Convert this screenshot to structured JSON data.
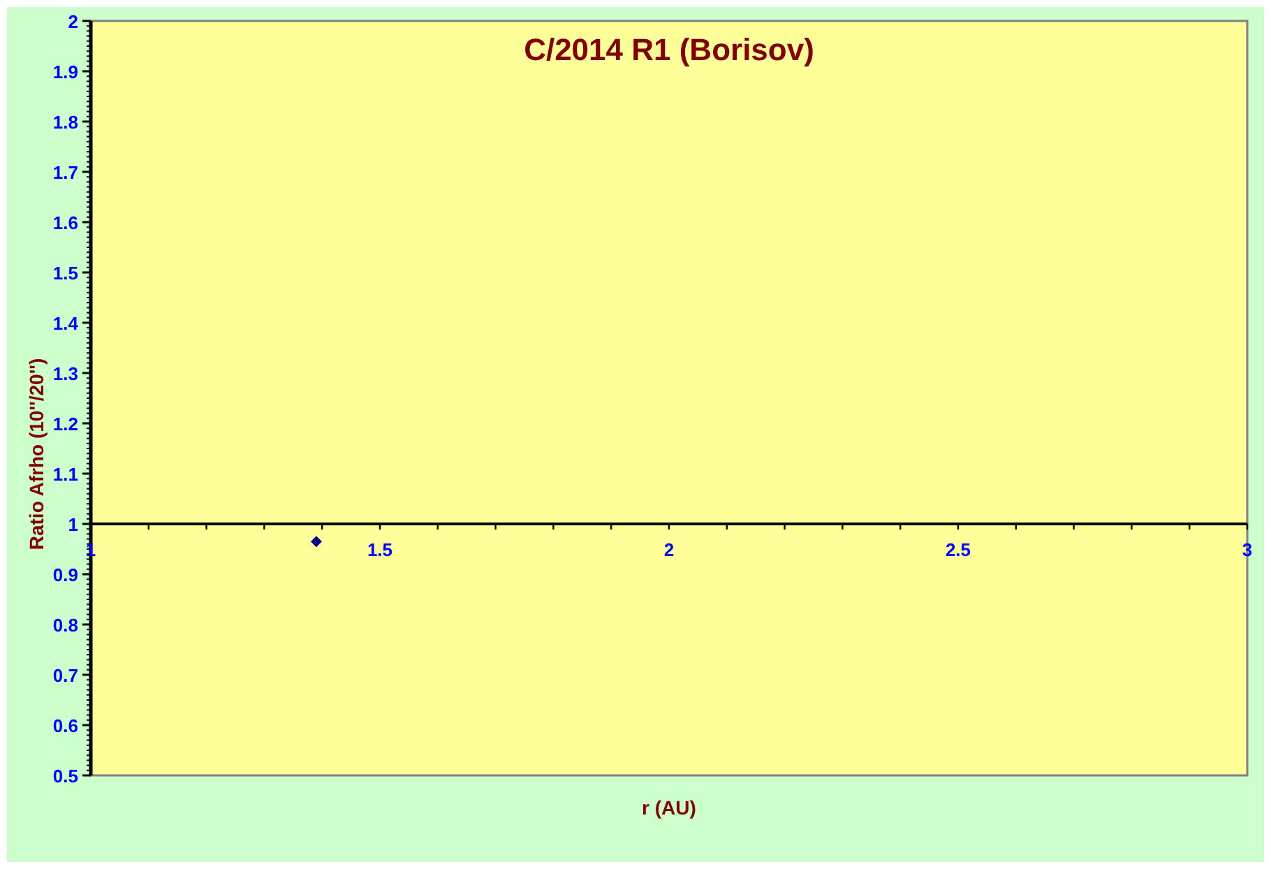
{
  "chart_data": {
    "type": "scatter",
    "title": "C/2014 R1 (Borisov)",
    "xlabel": "r (AU)",
    "ylabel": "Ratio Afrho (10''/20'')",
    "xlim": [
      1,
      3
    ],
    "ylim": [
      0.5,
      2
    ],
    "xticks": [
      1,
      1.5,
      2,
      2.5,
      3
    ],
    "yticks": [
      0.5,
      0.6,
      0.7,
      0.8,
      0.9,
      1,
      1.1,
      1.2,
      1.3,
      1.4,
      1.5,
      1.6,
      1.7,
      1.8,
      1.9,
      2
    ],
    "series": [
      {
        "color": "#000080",
        "x": [
          1.39
        ],
        "values": [
          0.965
        ]
      }
    ]
  }
}
